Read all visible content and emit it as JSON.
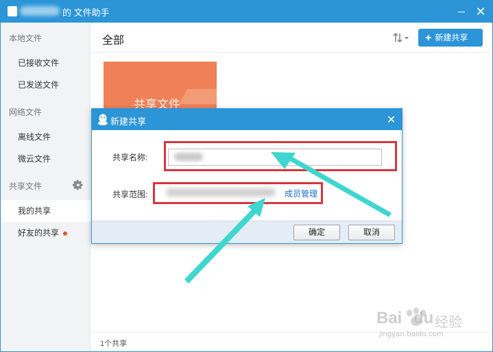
{
  "window": {
    "title": "的 文件助手",
    "close_glyph": "✕"
  },
  "sidebar": {
    "group_local": "本地文件",
    "received": "已接收文件",
    "sent": "已发送文件",
    "group_network": "网络文件",
    "offline": "离线文件",
    "cloud": "微云文件",
    "group_share": "共享文件",
    "my_share": "我的共享",
    "friend_share": "好友的共享"
  },
  "main": {
    "title": "全部",
    "new_share_label": "新建共享",
    "card_label": "共享文件",
    "footer_count": "1个共享"
  },
  "dialog": {
    "title": "新建共享",
    "name_label": "共享名称:",
    "scope_label": "共享范围:",
    "member_link": "成员管理",
    "ok_label": "确定",
    "cancel_label": "取消",
    "close_glyph": "✕"
  },
  "watermark": {
    "brand": "Bai",
    "brand2": "du",
    "cn": "经验",
    "url": "jingyan.baidu.com"
  },
  "colors": {
    "accent": "#2b95d8",
    "card": "#ef8158",
    "annotation_red": "#d9343d",
    "annotation_arrow": "#3fd6d0",
    "notification_dot": "#e8532e"
  }
}
